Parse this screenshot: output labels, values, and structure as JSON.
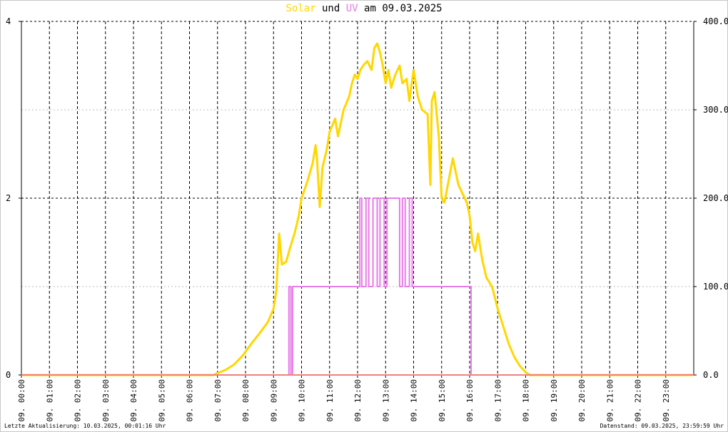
{
  "title": {
    "series_a": "Solar",
    "connector": "und",
    "series_b": "UV",
    "prefix": "am",
    "date": "09.03.2025"
  },
  "footer": {
    "left": "Letzte Aktualisierung: 10.03.2025, 00:01:16 Uhr",
    "right": "Datenstand: 09.03.2025, 23:59:59 Uhr"
  },
  "colors": {
    "solar": "#ffd700",
    "uv": "#e87be8",
    "baseline": "#f08080",
    "grid": "#000000",
    "grid_minor": "#bbbbbb"
  },
  "chart_data": {
    "type": "line",
    "title": "Solar und UV am 09.03.2025",
    "x_unit": "hour",
    "xlim": [
      0,
      24
    ],
    "x_ticks": [
      0,
      1,
      2,
      3,
      4,
      5,
      6,
      7,
      8,
      9,
      10,
      11,
      12,
      13,
      14,
      15,
      16,
      17,
      18,
      19,
      20,
      21,
      22,
      23
    ],
    "x_tick_labels": [
      "09. 00:00",
      "09. 01:00",
      "09. 02:00",
      "09. 03:00",
      "09. 04:00",
      "09. 05:00",
      "09. 06:00",
      "09. 07:00",
      "09. 08:00",
      "09. 09:00",
      "09. 10:00",
      "09. 11:00",
      "09. 12:00",
      "09. 13:00",
      "09. 14:00",
      "09. 15:00",
      "09. 16:00",
      "09. 17:00",
      "09. 18:00",
      "09. 19:00",
      "09. 20:00",
      "09. 21:00",
      "09. 22:00",
      "09. 23:00"
    ],
    "y_left": {
      "lim": [
        0,
        4
      ],
      "ticks": [
        0,
        2,
        4
      ],
      "tick_labels": [
        "0",
        "2",
        "4"
      ]
    },
    "y_right": {
      "lim": [
        0,
        400
      ],
      "ticks": [
        0,
        100,
        200,
        300,
        400
      ],
      "tick_labels": [
        "0.0",
        "100.0",
        "200.0",
        "300.0",
        "400.0"
      ]
    },
    "grid": true,
    "series": [
      {
        "name": "Solar",
        "axis": "right",
        "color": "#ffd700",
        "x": [
          0,
          6.85,
          7.0,
          7.3,
          7.6,
          7.9,
          8.2,
          8.5,
          8.8,
          9.0,
          9.1,
          9.2,
          9.3,
          9.45,
          9.6,
          9.75,
          9.9,
          10.0,
          10.2,
          10.4,
          10.5,
          10.55,
          10.65,
          10.75,
          10.9,
          11.0,
          11.2,
          11.3,
          11.4,
          11.5,
          11.7,
          11.8,
          11.9,
          12.0,
          12.1,
          12.2,
          12.35,
          12.5,
          12.6,
          12.7,
          12.8,
          12.9,
          13.0,
          13.1,
          13.2,
          13.35,
          13.5,
          13.6,
          13.75,
          13.85,
          14.0,
          14.15,
          14.3,
          14.5,
          14.6,
          14.65,
          14.75,
          14.9,
          15.0,
          15.1,
          15.25,
          15.4,
          15.5,
          15.6,
          15.75,
          15.9,
          16.0,
          16.1,
          16.2,
          16.3,
          16.45,
          16.6,
          16.8,
          17.0,
          17.2,
          17.4,
          17.6,
          17.8,
          18.0,
          18.15,
          18.25,
          24
        ],
        "values": [
          0,
          0,
          2,
          6,
          12,
          22,
          35,
          47,
          60,
          75,
          95,
          160,
          125,
          128,
          145,
          160,
          180,
          200,
          218,
          240,
          260,
          245,
          190,
          235,
          255,
          275,
          290,
          270,
          285,
          300,
          315,
          330,
          340,
          335,
          345,
          350,
          355,
          345,
          370,
          375,
          365,
          350,
          330,
          345,
          325,
          340,
          350,
          330,
          335,
          310,
          345,
          315,
          300,
          295,
          215,
          310,
          320,
          270,
          200,
          195,
          220,
          245,
          230,
          215,
          205,
          195,
          180,
          150,
          140,
          160,
          130,
          110,
          100,
          75,
          55,
          35,
          20,
          10,
          3,
          0,
          0,
          0
        ]
      },
      {
        "name": "UV",
        "axis": "left",
        "color": "#e87be8",
        "x": [
          0,
          9.55,
          9.55,
          9.62,
          9.62,
          9.68,
          9.68,
          12.08,
          12.08,
          12.15,
          12.15,
          12.3,
          12.3,
          12.4,
          12.4,
          12.55,
          12.55,
          12.7,
          12.7,
          12.8,
          12.8,
          12.95,
          12.95,
          13.05,
          13.05,
          13.5,
          13.5,
          13.6,
          13.6,
          13.7,
          13.7,
          13.85,
          13.85,
          13.95,
          13.95,
          14.0,
          14.0,
          16.05,
          16.05,
          24
        ],
        "values": [
          0,
          0,
          1,
          1,
          0,
          0,
          1,
          1,
          2,
          2,
          1,
          1,
          2,
          2,
          1,
          1,
          2,
          2,
          1,
          1,
          2,
          2,
          1,
          1,
          2,
          2,
          1,
          1,
          2,
          2,
          1,
          1,
          2,
          2,
          1,
          1,
          1,
          1,
          0,
          0
        ]
      }
    ]
  }
}
